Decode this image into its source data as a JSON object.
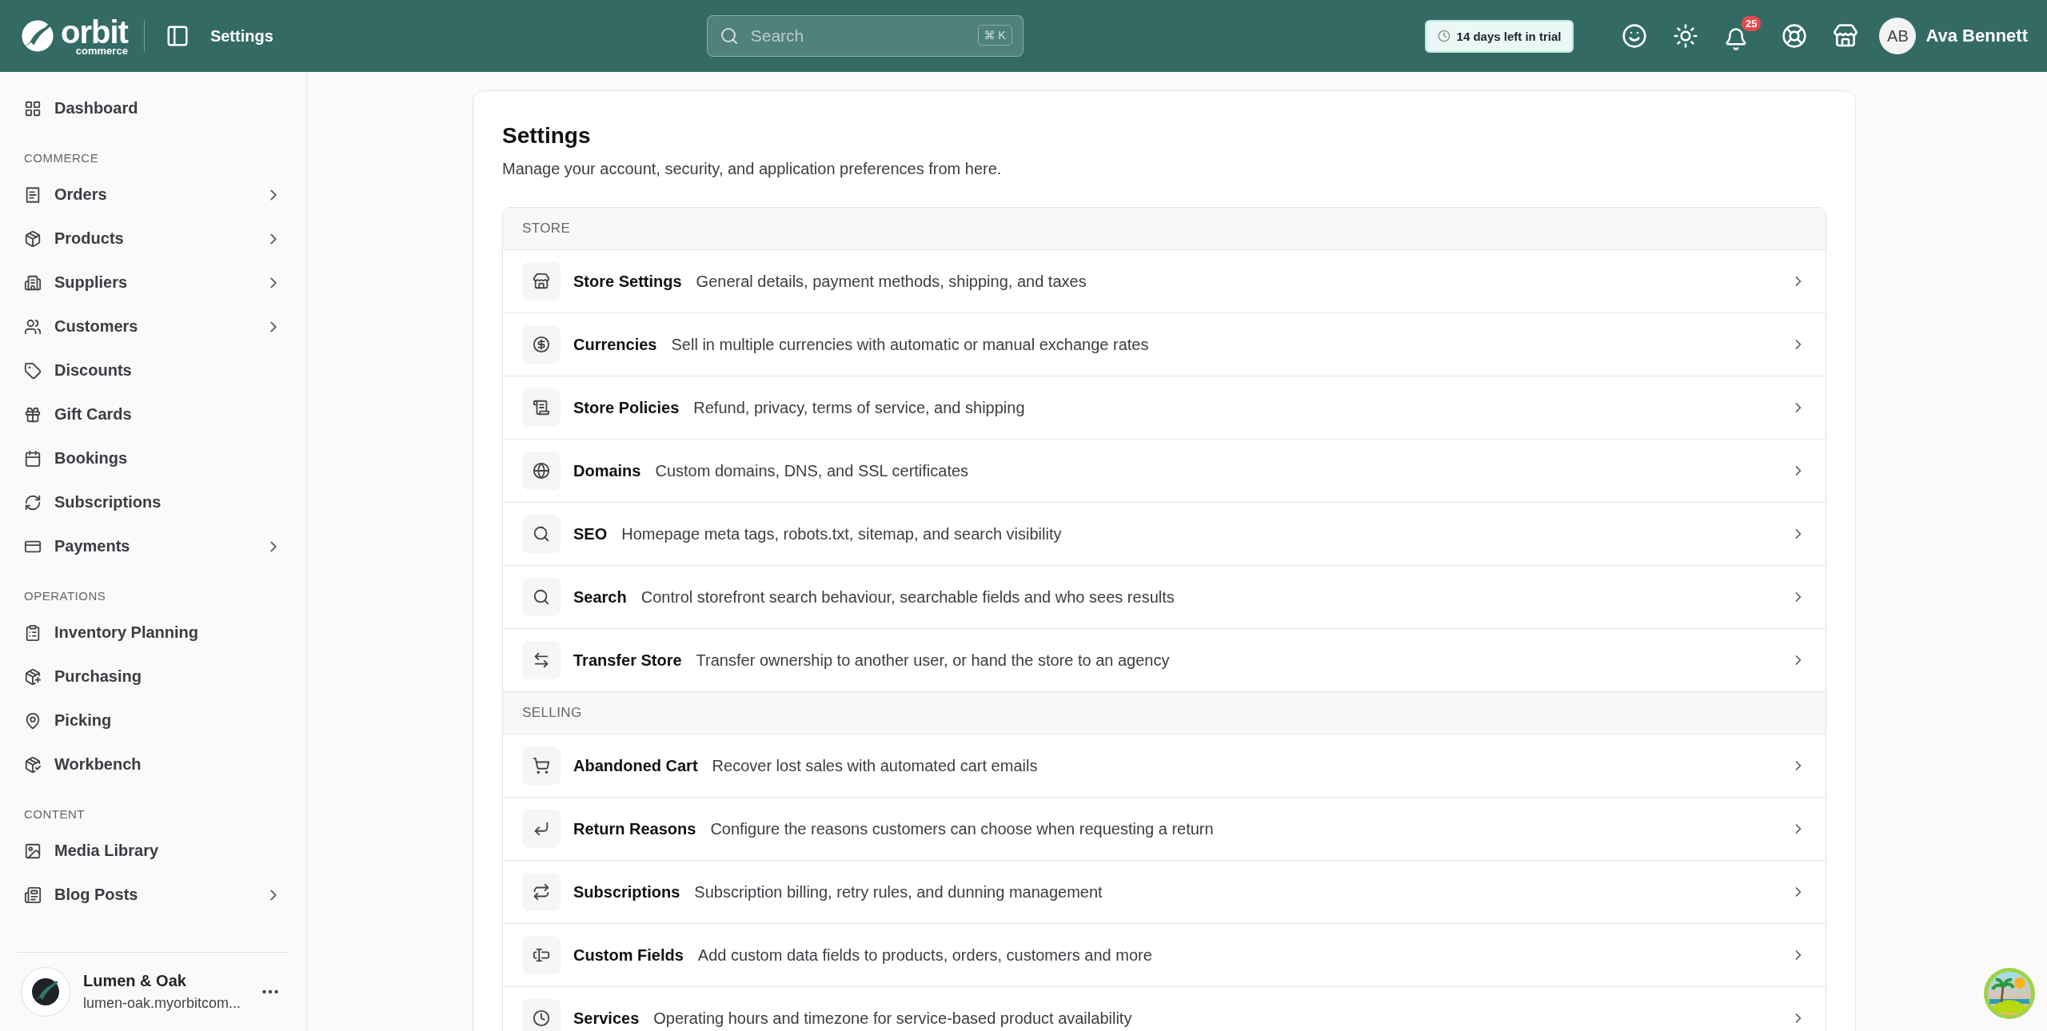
{
  "header": {
    "logo": {
      "name": "orbit",
      "tagline": "commerce"
    },
    "page_title": "Settings",
    "search": {
      "placeholder": "Search",
      "shortcut": "⌘ K"
    },
    "trial_badge": "14 days left in trial",
    "notifications": {
      "count": "25"
    },
    "user": {
      "initials": "AB",
      "name": "Ava Bennett"
    }
  },
  "sidebar": {
    "sections": [
      {
        "items": [
          {
            "label": "Dashboard",
            "expandable": false
          }
        ]
      },
      {
        "title": "COMMERCE",
        "items": [
          {
            "label": "Orders",
            "expandable": true
          },
          {
            "label": "Products",
            "expandable": true
          },
          {
            "label": "Suppliers",
            "expandable": true
          },
          {
            "label": "Customers",
            "expandable": true
          },
          {
            "label": "Discounts",
            "expandable": false
          },
          {
            "label": "Gift Cards",
            "expandable": false
          },
          {
            "label": "Bookings",
            "expandable": false
          },
          {
            "label": "Subscriptions",
            "expandable": false
          },
          {
            "label": "Payments",
            "expandable": true
          }
        ]
      },
      {
        "title": "OPERATIONS",
        "items": [
          {
            "label": "Inventory Planning",
            "expandable": false
          },
          {
            "label": "Purchasing",
            "expandable": false
          },
          {
            "label": "Picking",
            "expandable": false
          },
          {
            "label": "Workbench",
            "expandable": false
          }
        ]
      },
      {
        "title": "CONTENT",
        "items": [
          {
            "label": "Media Library",
            "expandable": false
          },
          {
            "label": "Blog Posts",
            "expandable": true
          }
        ]
      }
    ],
    "store": {
      "name": "Lumen & Oak",
      "domain": "lumen-oak.myorbitcom..."
    }
  },
  "settings": {
    "title": "Settings",
    "subtitle": "Manage your account, security, and application preferences from here.",
    "groups": [
      {
        "title": "STORE",
        "rows": [
          {
            "title": "Store Settings",
            "description": "General details, payment methods, shipping, and taxes"
          },
          {
            "title": "Currencies",
            "description": "Sell in multiple currencies with automatic or manual exchange rates"
          },
          {
            "title": "Store Policies",
            "description": "Refund, privacy, terms of service, and shipping"
          },
          {
            "title": "Domains",
            "description": "Custom domains, DNS, and SSL certificates"
          },
          {
            "title": "SEO",
            "description": "Homepage meta tags, robots.txt, sitemap, and search visibility"
          },
          {
            "title": "Search",
            "description": "Control storefront search behaviour, searchable fields and who sees results"
          },
          {
            "title": "Transfer Store",
            "description": "Transfer ownership to another user, or hand the store to an agency"
          }
        ]
      },
      {
        "title": "SELLING",
        "rows": [
          {
            "title": "Abandoned Cart",
            "description": "Recover lost sales with automated cart emails"
          },
          {
            "title": "Return Reasons",
            "description": "Configure the reasons customers can choose when requesting a return"
          },
          {
            "title": "Subscriptions",
            "description": "Subscription billing, retry rules, and dunning management"
          },
          {
            "title": "Custom Fields",
            "description": "Add custom data fields to products, orders, customers and more"
          },
          {
            "title": "Services",
            "description": "Operating hours and timezone for service-based product availability"
          }
        ]
      }
    ]
  }
}
